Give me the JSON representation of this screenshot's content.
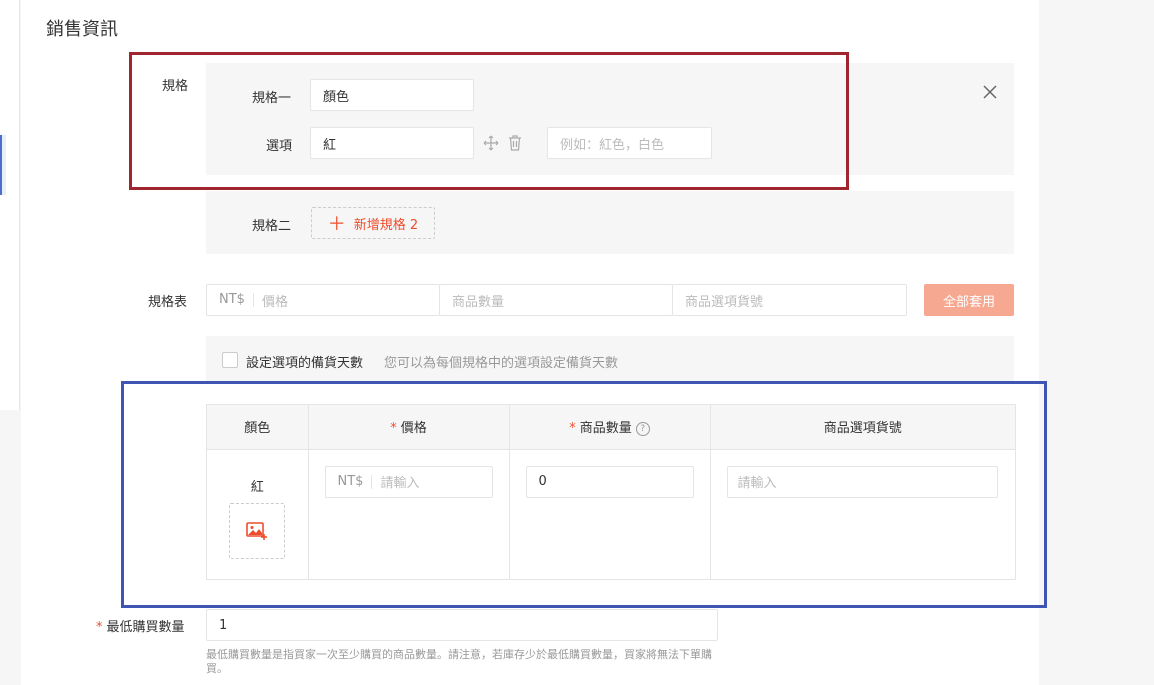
{
  "section_title": "銷售資訊",
  "spec": {
    "label": "規格",
    "spec1_label": "規格一",
    "spec1_value": "顏色",
    "option_label": "選項",
    "option_value": "紅",
    "option_placeholder": "例如：紅色，白色",
    "spec2_label": "規格二",
    "add_spec2": "新增規格 2"
  },
  "spec_table": {
    "label": "規格表",
    "currency": "NT$",
    "price_placeholder": "價格",
    "qty_placeholder": "商品數量",
    "sku_placeholder": "商品選項貨號",
    "apply_all": "全部套用"
  },
  "lead_time": {
    "label": "設定選項的備貨天數",
    "hint": "您可以為每個規格中的選項設定備貨天數"
  },
  "variation_table": {
    "headers": {
      "color": "顏色",
      "price": "價格",
      "qty": "商品數量",
      "sku": "商品選項貨號"
    },
    "rows": [
      {
        "color": "紅",
        "currency": "NT$",
        "price_placeholder": "請輸入",
        "qty": "0",
        "sku_placeholder": "請輸入"
      }
    ]
  },
  "min_purchase": {
    "label": "最低購買數量",
    "value": "1",
    "hint": "最低購買數量是指買家一次至少購買的商品數量。請注意，若庫存少於最低購買數量，買家將無法下單購買。"
  },
  "colors": {
    "accent": "#ee4d2d",
    "apply_disabled": "#f7a891",
    "highlight_red": "#a0252e",
    "highlight_blue": "#3e55b4"
  },
  "icons": [
    "close-icon",
    "move-icon",
    "trash-icon",
    "plus-icon",
    "question-icon",
    "image-add-icon"
  ]
}
